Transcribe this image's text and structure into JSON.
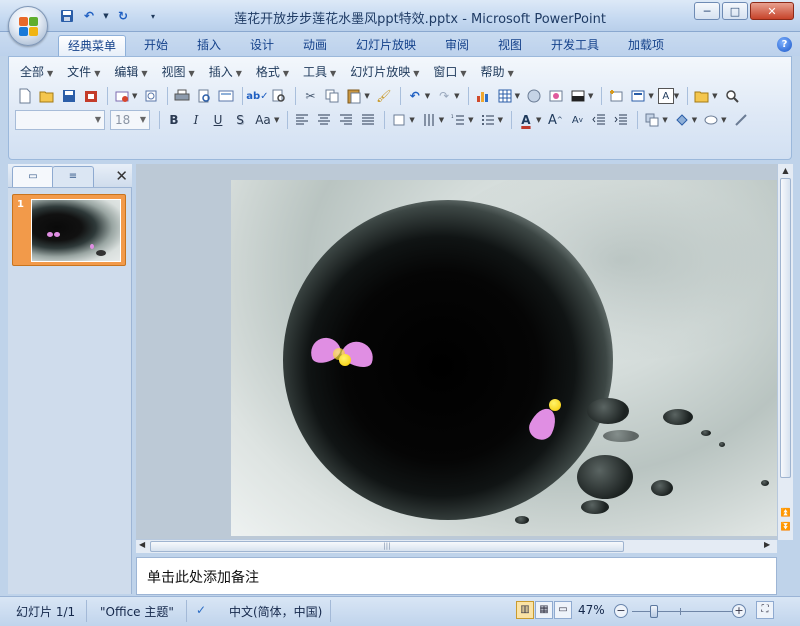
{
  "window": {
    "title": "莲花开放步步莲花水墨风ppt特效.pptx - Microsoft PowerPoint",
    "minimize": "─",
    "maximize": "□",
    "close": "✕"
  },
  "qat": {
    "save_icon": "save-icon",
    "undo_icon": "undo-icon",
    "redo_icon": "redo-icon",
    "customize_icon": "customize-icon"
  },
  "tabs": [
    "经典菜单",
    "开始",
    "插入",
    "设计",
    "动画",
    "幻灯片放映",
    "审阅",
    "视图",
    "开发工具",
    "加载项"
  ],
  "help": "?",
  "menu": [
    "全部",
    "文件",
    "编辑",
    "视图",
    "插入",
    "格式",
    "工具",
    "幻灯片放映",
    "窗口",
    "帮助"
  ],
  "font": {
    "name": "",
    "size": "18"
  },
  "format_buttons": [
    "B",
    "I",
    "U",
    "S",
    "Aa"
  ],
  "slides_panel": {
    "slide_number": "1"
  },
  "notes": {
    "placeholder": "单击此处添加备注"
  },
  "status": {
    "slide": "幻灯片 1/1",
    "theme": "\"Office 主题\"",
    "language": "中文(简体，中国)",
    "zoom": "47%",
    "zoom_minus": "−",
    "zoom_plus": "+"
  },
  "colors": {
    "accent": "#f29a4a",
    "petal": "#e08ee3",
    "pollen": "#f5c800"
  }
}
